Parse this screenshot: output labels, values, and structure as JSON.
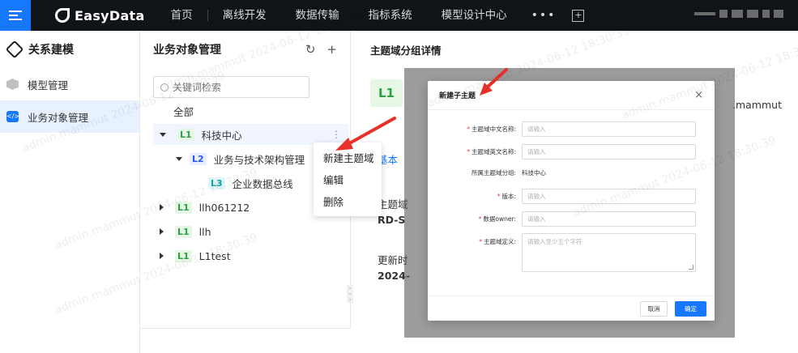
{
  "topbar": {
    "logo": "EasyData",
    "nav": [
      "首页",
      "离线开发",
      "数据传输",
      "指标系统",
      "模型设计中心"
    ],
    "more": "•••",
    "plus": "+"
  },
  "sidebar": {
    "title": "关系建模",
    "items": [
      {
        "label": "模型管理",
        "icon": "cube-icon",
        "active": false
      },
      {
        "label": "业务对象管理",
        "icon": "code-folder-icon",
        "active": true
      }
    ]
  },
  "tree_panel": {
    "title": "业务对象管理",
    "search_placeholder": "关键词检索",
    "all_label": "全部",
    "nodes": [
      {
        "level": "L1",
        "label": "科技中心",
        "expanded": true,
        "selected": true
      },
      {
        "level": "L2",
        "label": "业务与技术架构管理",
        "expanded": true
      },
      {
        "level": "L3",
        "label": "企业数据总线"
      },
      {
        "level": "L1",
        "label": "llh061212",
        "expanded": false
      },
      {
        "level": "L1",
        "label": "llh",
        "expanded": false
      },
      {
        "level": "L1",
        "label": "L1test",
        "expanded": false
      }
    ]
  },
  "context_menu": {
    "items": [
      "新建主题域",
      "编辑",
      "删除"
    ]
  },
  "detail": {
    "title": "主题域分组详情",
    "badge": "L1",
    "frag_basic": "基本",
    "frag_domain": "主题域",
    "frag_code": "RD-S",
    "frag_updated": "更新时",
    "frag_date": "2024-",
    "frag_owner": ".mammut"
  },
  "modal": {
    "title": "新建子主题",
    "fields": [
      {
        "label": "主题域中文名称:",
        "required": true,
        "placeholder": "请输入"
      },
      {
        "label": "主题域英文名称:",
        "required": true,
        "placeholder": "请输入"
      },
      {
        "label": "所属主题域分组:",
        "required": false,
        "value": "科技中心"
      },
      {
        "label": "版本:",
        "required": true,
        "placeholder": "请输入"
      },
      {
        "label": "数据owner:",
        "required": true,
        "placeholder": "请输入"
      },
      {
        "label": "主题域定义:",
        "required": true,
        "placeholder": "请输入至少五个字符"
      }
    ],
    "cancel": "取消",
    "ok": "确定"
  },
  "watermark": "admin.mammut 2024-06-12 18:30:39",
  "colors": {
    "accent": "#1677ff",
    "arrow": "#e8302a",
    "topbar": "#101318"
  }
}
